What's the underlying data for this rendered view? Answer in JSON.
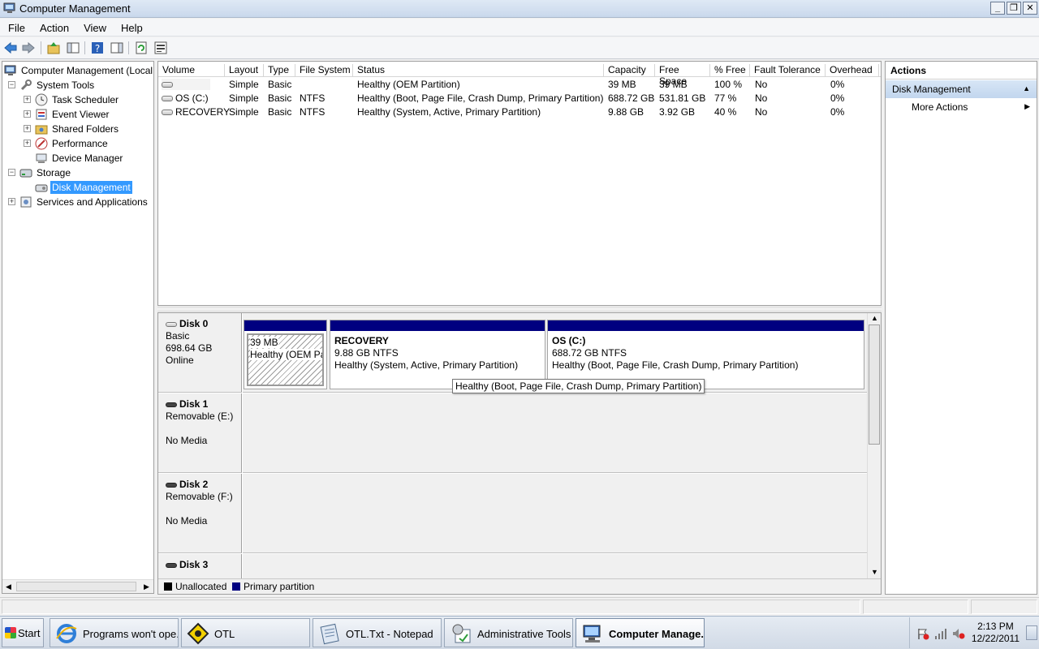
{
  "window": {
    "title": "Computer Management"
  },
  "menu": [
    "File",
    "Action",
    "View",
    "Help"
  ],
  "tree": {
    "root": "Computer Management (Local",
    "system_tools": "System Tools",
    "task_scheduler": "Task Scheduler",
    "event_viewer": "Event Viewer",
    "shared_folders": "Shared Folders",
    "performance": "Performance",
    "device_manager": "Device Manager",
    "storage": "Storage",
    "disk_management": "Disk Management",
    "services_apps": "Services and Applications"
  },
  "volumes": {
    "columns": [
      "Volume",
      "Layout",
      "Type",
      "File System",
      "Status",
      "Capacity",
      "Free Space",
      "% Free",
      "Fault Tolerance",
      "Overhead"
    ],
    "rows": [
      {
        "volume": "",
        "layout": "Simple",
        "type": "Basic",
        "fs": "",
        "status": "Healthy (OEM Partition)",
        "capacity": "39 MB",
        "free": "39 MB",
        "pct": "100 %",
        "fault": "No",
        "overhead": "0%"
      },
      {
        "volume": "OS (C:)",
        "layout": "Simple",
        "type": "Basic",
        "fs": "NTFS",
        "status": "Healthy (Boot, Page File, Crash Dump, Primary Partition)",
        "capacity": "688.72 GB",
        "free": "531.81 GB",
        "pct": "77 %",
        "fault": "No",
        "overhead": "0%"
      },
      {
        "volume": "RECOVERY",
        "layout": "Simple",
        "type": "Basic",
        "fs": "NTFS",
        "status": "Healthy (System, Active, Primary Partition)",
        "capacity": "9.88 GB",
        "free": "3.92 GB",
        "pct": "40 %",
        "fault": "No",
        "overhead": "0%"
      }
    ]
  },
  "disks": {
    "disk0": {
      "name": "Disk 0",
      "type": "Basic",
      "size": "698.64 GB",
      "state": "Online"
    },
    "disk1": {
      "name": "Disk 1",
      "type": "Removable (E:)",
      "state": "No Media"
    },
    "disk2": {
      "name": "Disk 2",
      "type": "Removable (F:)",
      "state": "No Media"
    },
    "disk3": {
      "name": "Disk 3"
    },
    "partitions": {
      "oem": {
        "size": "39 MB",
        "status": "Healthy (OEM Pa"
      },
      "recovery": {
        "name": "RECOVERY",
        "size": "9.88 GB NTFS",
        "status": "Healthy (System, Active, Primary Partition)"
      },
      "os": {
        "name": "OS  (C:)",
        "size": "688.72 GB NTFS",
        "status": "Healthy (Boot, Page File, Crash Dump, Primary Partition)"
      }
    }
  },
  "tooltip": "Healthy (Boot, Page File, Crash Dump, Primary Partition)",
  "legend": {
    "unallocated": "Unallocated",
    "primary": "Primary partition"
  },
  "actions": {
    "header": "Actions",
    "section": "Disk Management",
    "more": "More Actions"
  },
  "taskbar": {
    "start": "Start",
    "items": [
      "Programs won't ope...",
      "OTL",
      "OTL.Txt - Notepad",
      "Administrative Tools",
      "Computer Manage..."
    ],
    "time": "2:13 PM",
    "date": "12/22/2011"
  },
  "colors": {
    "primary_partition": "#000080",
    "unallocated": "#000000",
    "selection": "#3399ff"
  }
}
